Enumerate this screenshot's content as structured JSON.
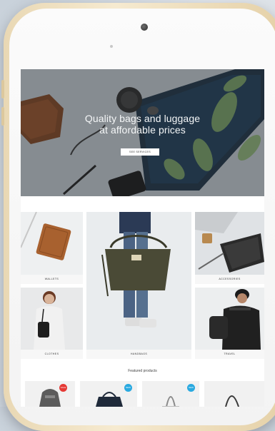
{
  "hero": {
    "title_line1": "Quality bags and luggage",
    "title_line2": "at affordable prices",
    "button_label": "SEE SERVICES"
  },
  "categories": [
    {
      "label": "WALLETS"
    },
    {
      "label": "HANDBAGS"
    },
    {
      "label": "ACCESSORIES"
    },
    {
      "label": "CLOTHES"
    },
    {
      "label": "TRAVEL"
    }
  ],
  "featured": {
    "title": "Featured products",
    "badges": [
      {
        "text": "SALE",
        "color": "#e53935"
      },
      {
        "text": "NEW",
        "color": "#29a9e0"
      },
      {
        "text": "NEW",
        "color": "#29a9e0"
      }
    ]
  },
  "colors": {
    "phone_gold": "#efdfbe",
    "screen_bg": "#ffffff"
  }
}
